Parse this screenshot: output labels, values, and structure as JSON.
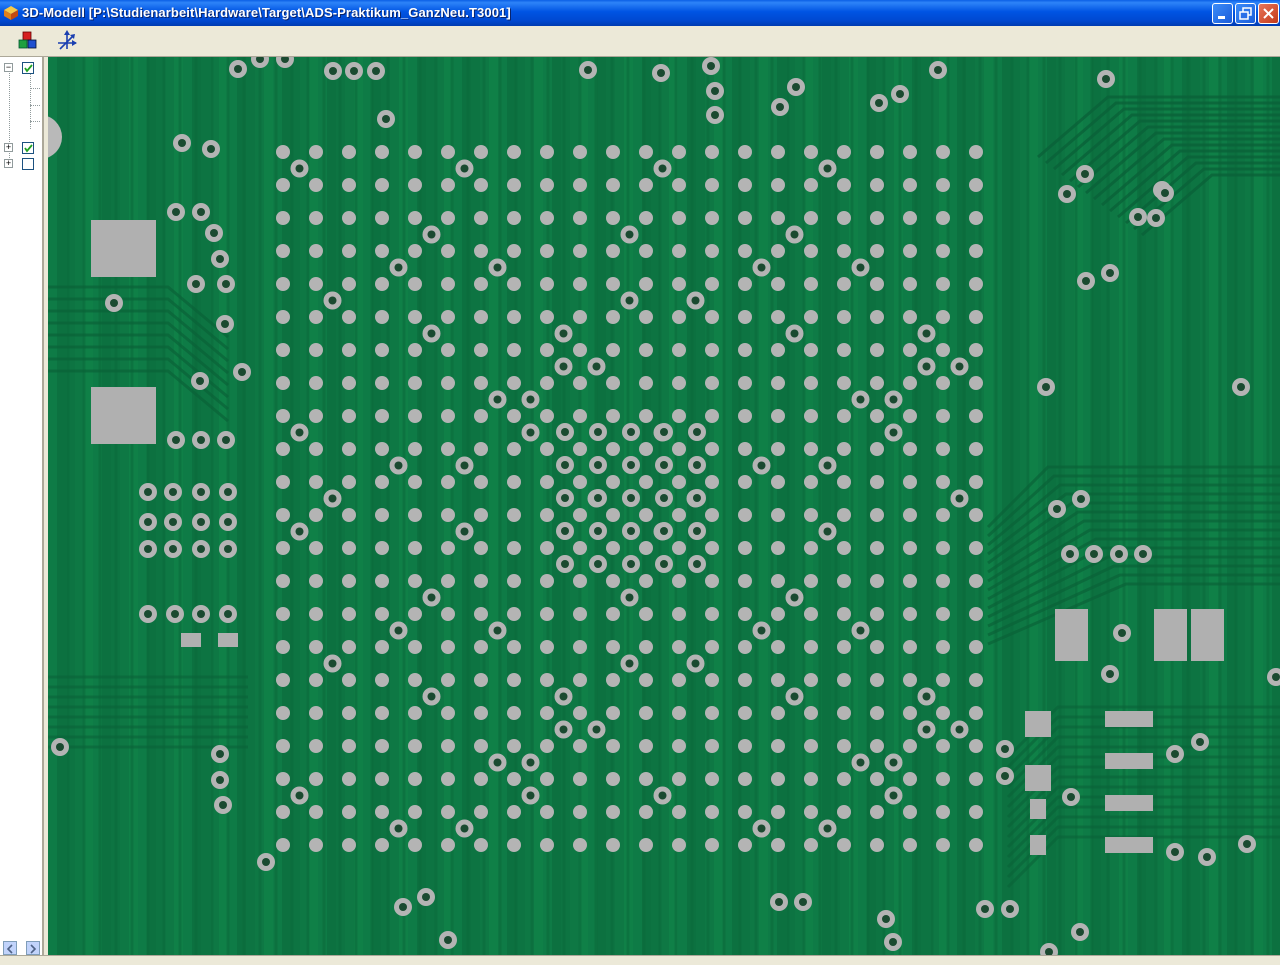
{
  "window": {
    "title": "3D-Modell  [P:\\Studienarbeit\\Hardware\\Target\\ADS-Praktikum_GanzNeu.T3001]",
    "app_icon": "3d-model-icon",
    "controls": [
      "minimize-icon",
      "restore-icon",
      "close-icon"
    ]
  },
  "toolbar": {
    "buttons": [
      {
        "name": "color-layers-button",
        "icon": "color-cubes-icon"
      },
      {
        "name": "axis-view-button",
        "icon": "axis-arrows-icon"
      }
    ]
  },
  "tree": {
    "items": [
      {
        "expander": "−",
        "checked": true
      },
      {
        "expander": "+",
        "checked": true
      },
      {
        "expander": "+",
        "checked": false
      }
    ]
  },
  "viewport": {
    "board_color": "#0E7A45",
    "trace_color": "#0B6B3C",
    "pad_color": "#B4B4B4",
    "via_hole_color": "#1A4A30",
    "ball_pitch": 33,
    "ball_rows": 22,
    "ball_cols": 22
  }
}
